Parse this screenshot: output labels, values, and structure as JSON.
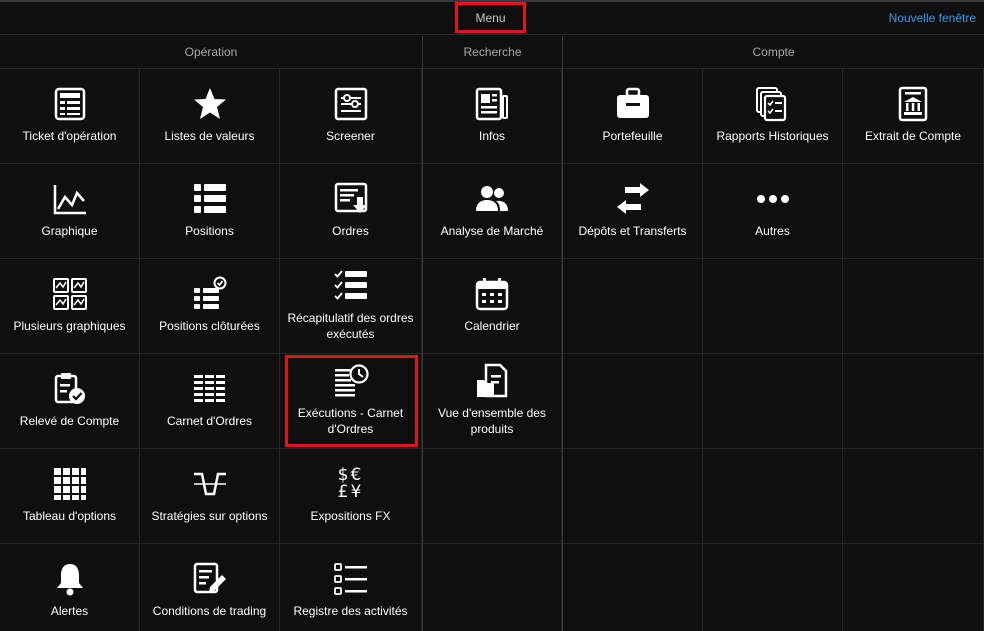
{
  "header": {
    "title": "Menu",
    "new_window": "Nouvelle fenêtre"
  },
  "sections": {
    "operation": "Opération",
    "recherche": "Recherche",
    "compte": "Compte"
  },
  "operation": [
    {
      "label": "Ticket d'opération",
      "icon": "ticket-icon"
    },
    {
      "label": "Listes de valeurs",
      "icon": "star-icon"
    },
    {
      "label": "Screener",
      "icon": "sliders-icon"
    },
    {
      "label": "Graphique",
      "icon": "line-chart-icon"
    },
    {
      "label": "Positions",
      "icon": "list-icon"
    },
    {
      "label": "Ordres",
      "icon": "orders-icon"
    },
    {
      "label": "Plusieurs graphiques",
      "icon": "multi-chart-icon"
    },
    {
      "label": "Positions clôturées",
      "icon": "closed-positions-icon"
    },
    {
      "label": "Récapitulatif des ordres exécutés",
      "icon": "checklist-icon"
    },
    {
      "label": "Relevé de Compte",
      "icon": "clipboard-check-icon"
    },
    {
      "label": "Carnet d'Ordres",
      "icon": "order-book-icon"
    },
    {
      "label": "Exécutions - Carnet d'Ordres",
      "icon": "executions-clock-icon"
    },
    {
      "label": "Tableau d'options",
      "icon": "grid-icon"
    },
    {
      "label": "Stratégies sur options",
      "icon": "strategy-icon"
    },
    {
      "label": "Expositions FX",
      "icon": "currency-icon",
      "glyph1": "$€",
      "glyph2": "£¥"
    },
    {
      "label": "Alertes",
      "icon": "bell-icon"
    },
    {
      "label": "Conditions de trading",
      "icon": "edit-document-icon"
    },
    {
      "label": "Registre des activités",
      "icon": "activity-list-icon"
    }
  ],
  "recherche": [
    {
      "label": "Infos",
      "icon": "newspaper-icon"
    },
    {
      "label": "Analyse de Marché",
      "icon": "users-icon"
    },
    {
      "label": "Calendrier",
      "icon": "calendar-icon"
    },
    {
      "label": "Vue d'ensemble des produits",
      "icon": "folder-document-icon"
    }
  ],
  "compte": [
    {
      "label": "Portefeuille",
      "icon": "briefcase-icon"
    },
    {
      "label": "Rapports Historiques",
      "icon": "reports-icon"
    },
    {
      "label": "Extrait de Compte",
      "icon": "bank-statement-icon"
    },
    {
      "label": "Dépôts et Transferts",
      "icon": "transfer-arrows-icon"
    },
    {
      "label": "Autres",
      "icon": "more-icon"
    }
  ]
}
